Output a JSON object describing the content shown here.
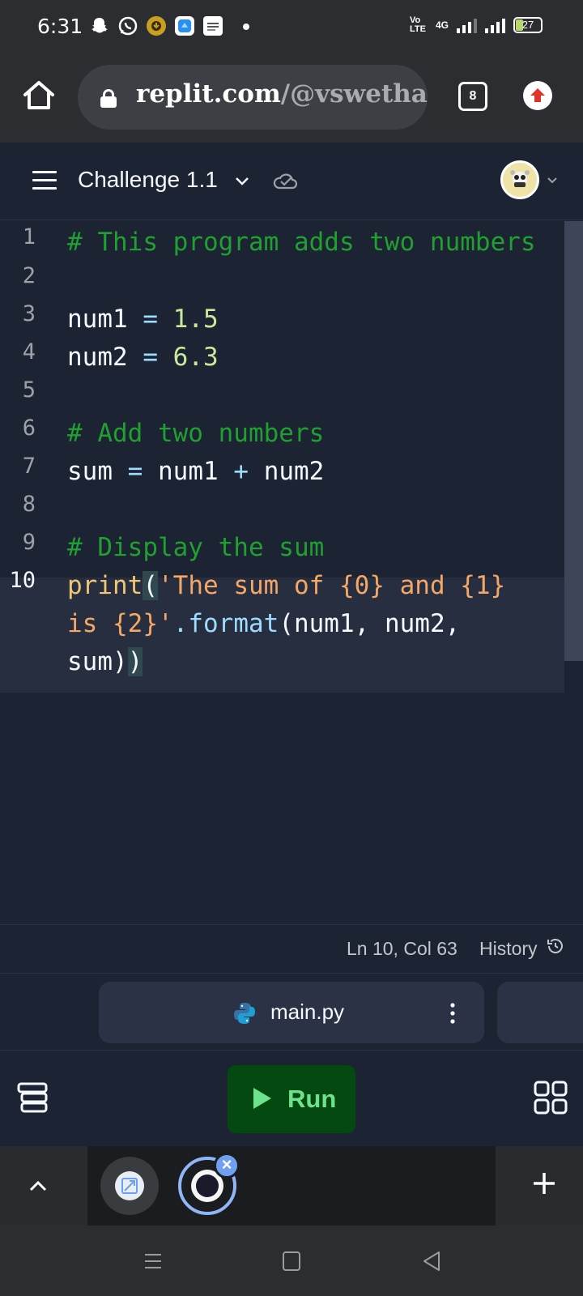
{
  "status_bar": {
    "time": "6:31",
    "network_label": "Vo LTE",
    "network_type": "4G",
    "battery": "27"
  },
  "browser": {
    "url_domain": "replit.com",
    "url_path": "/@vswethacs",
    "tab_count": "8"
  },
  "repl": {
    "title": "Challenge 1.1"
  },
  "editor": {
    "lines": [
      {
        "num": "1",
        "text": "# This program adds two numbers"
      },
      {
        "num": "2",
        "text": ""
      },
      {
        "num": "3",
        "text": "num1 = 1.5"
      },
      {
        "num": "4",
        "text": "num2 = 6.3"
      },
      {
        "num": "5",
        "text": ""
      },
      {
        "num": "6",
        "text": "# Add two numbers"
      },
      {
        "num": "7",
        "text": "sum = num1 + num2"
      },
      {
        "num": "8",
        "text": ""
      },
      {
        "num": "9",
        "text": "# Display the sum"
      },
      {
        "num": "10",
        "text": "print('The sum of {0} and {1} is {2}'.format(num1, num2, sum))"
      }
    ],
    "tokens": {
      "l1": "# This program adds two numbers",
      "l3_id": "num1",
      "l3_op": "=",
      "l3_num": "1.5",
      "l4_id": "num2",
      "l4_op": "=",
      "l4_num": "6.3",
      "l6": "# Add two numbers",
      "l7_a": "sum",
      "l7_op1": "=",
      "l7_b": "num1",
      "l7_op2": "+",
      "l7_c": "num2",
      "l9": "# Display the sum",
      "l10_fn": "print",
      "l10_open": "(",
      "l10_str1": "'The sum of {0} and {1}",
      "l10_str2": "is {2}'",
      "l10_dot": ".",
      "l10_meth": "format",
      "l10_args": "(num1, num2,",
      "l10_last": "sum)",
      "l10_close": ")"
    }
  },
  "status_line": {
    "cursor": "Ln 10, Col 63",
    "history": "History"
  },
  "file_tab": {
    "name": "main.py"
  },
  "toolbar": {
    "run_label": "Run"
  },
  "colors": {
    "background": "#1c2333",
    "comment": "#20a030",
    "number": "#c9e99a",
    "string": "#f4a766",
    "function": "#f0c674",
    "run_button": "#044a10",
    "run_text": "#6ce38a"
  },
  "icons": [
    "home-icon",
    "lock-icon",
    "tabs-icon",
    "upload-icon",
    "hamburger-icon",
    "chevron-down-icon",
    "cloud-check-icon",
    "avatar",
    "history-icon",
    "python-icon",
    "kebab-icon",
    "layout-icon",
    "play-icon",
    "grid-icon",
    "chevron-up-icon",
    "plus-icon",
    "close-icon"
  ]
}
